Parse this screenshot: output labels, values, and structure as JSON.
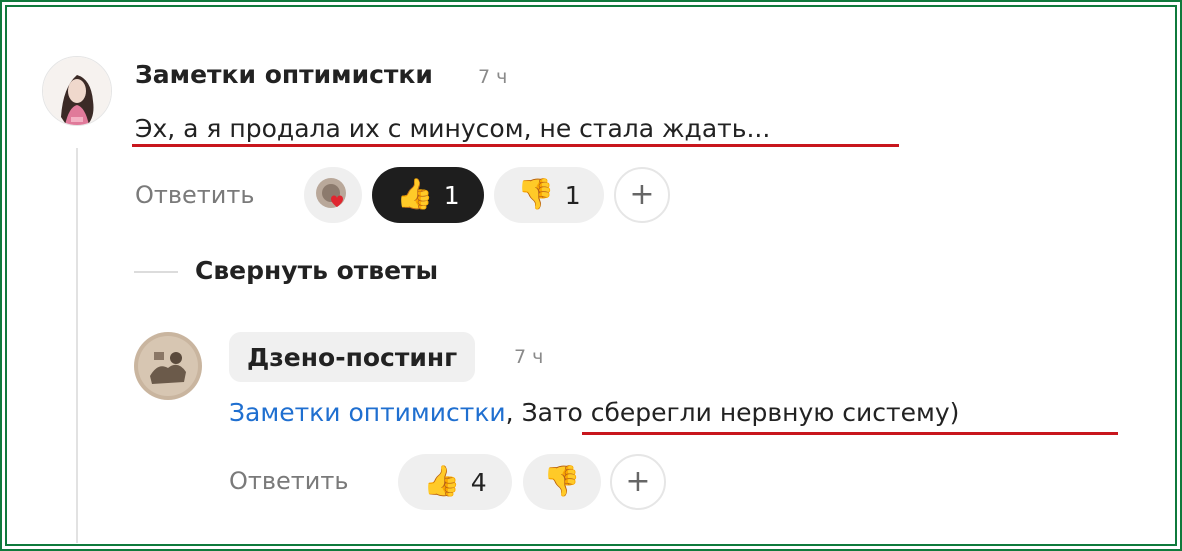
{
  "comment1": {
    "author": "Заметки оптимистки",
    "time": "7 ч",
    "text": "Эх, а я продала их с минусом, не стала ждать...",
    "reply_label": "Ответить",
    "reactions": {
      "heart_icon": "avatar-heart-reaction",
      "like_emoji": "👍",
      "like_count": "1",
      "dislike_emoji": "👎",
      "dislike_count": "1",
      "add_symbol": "+"
    }
  },
  "collapse_label": "Свернуть ответы",
  "reply1": {
    "author": "Дзено-постинг",
    "time": "7 ч",
    "mention": "Заметки оптимистки",
    "separator": ",",
    "text": " Зато сберегли нервную систему)",
    "reply_label": "Ответить",
    "reactions": {
      "like_emoji": "👍",
      "like_count": "4",
      "dislike_emoji": "👎",
      "add_symbol": "+"
    }
  },
  "colors": {
    "frame": "#0f7a3c",
    "underline": "#c8161d",
    "mention": "#1f6fd0",
    "pill": "#efefef",
    "pill_active": "#1e1e1e"
  }
}
